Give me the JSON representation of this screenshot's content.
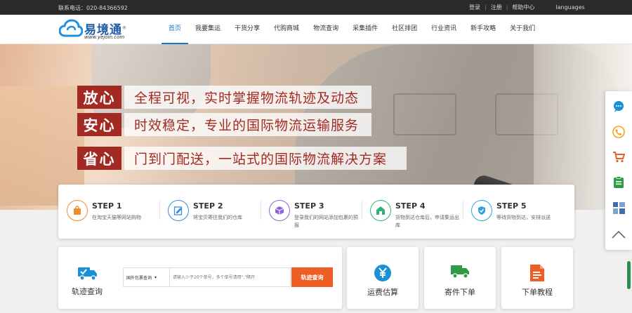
{
  "topbar": {
    "contact": "联系电话：020-84366592",
    "links": {
      "login": "登录",
      "register": "注册",
      "help": "帮助中心",
      "languages": "languages"
    }
  },
  "logo": {
    "name": "易境通",
    "reg": "®",
    "url": "www.yejoin.com"
  },
  "nav": {
    "items": [
      "首页",
      "我要集运",
      "干货分享",
      "代购商城",
      "物流查询",
      "采集插件",
      "社区排团",
      "行业资讯",
      "新手攻略",
      "关于我们"
    ],
    "active_index": 0
  },
  "banner": {
    "slogans": [
      {
        "tag": "放心",
        "text": "全程可视，实时掌握物流轨迹及动态"
      },
      {
        "tag": "安心",
        "text": "时效稳定，专业的国际物流运输服务"
      },
      {
        "tag": "省心",
        "text": "门到门配送，一站式的国际物流解决方案"
      }
    ]
  },
  "steps": [
    {
      "title": "STEP 1",
      "desc": "在淘宝天猫等网站购物",
      "icon": "shopping-bag-icon",
      "color": "#f08c2c"
    },
    {
      "title": "STEP 2",
      "desc": "将宝贝寄往我们的仓库",
      "icon": "edit-form-icon",
      "color": "#3b8be0"
    },
    {
      "title": "STEP 3",
      "desc": "登录我们的网站添加包裹的预报",
      "icon": "package-icon",
      "color": "#8a64d8"
    },
    {
      "title": "STEP 4",
      "desc": "货物到达仓库后，申请集运出库",
      "icon": "warehouse-icon",
      "color": "#2fb573"
    },
    {
      "title": "STEP 5",
      "desc": "等待货物到达，安排派送",
      "icon": "shield-check-icon",
      "color": "#2fa3e0"
    }
  ],
  "tracking": {
    "label": "轨迹查询",
    "select_value": "国外包裹查询",
    "placeholder": "请输入少于20个单号，多个单号请用\",\"隔开",
    "button": "轨迹查询"
  },
  "services": [
    {
      "label": "运费估算",
      "icon": "yen-coin-icon",
      "color": "#1a90d6"
    },
    {
      "label": "寄件下单",
      "icon": "truck-icon",
      "color": "#2e9b45"
    },
    {
      "label": "下单教程",
      "icon": "document-icon",
      "color": "#ee5d24"
    }
  ],
  "sidebar": [
    {
      "icon": "chat-bubble-icon",
      "color": "#1a90d6"
    },
    {
      "icon": "phone-icon",
      "color": "#f0a21d"
    },
    {
      "icon": "cart-icon",
      "color": "#ee5d24"
    },
    {
      "icon": "clipboard-icon",
      "color": "#2e9b45"
    },
    {
      "icon": "grid-icon",
      "color": "#3f6ea8"
    },
    {
      "icon": "back-to-top-icon",
      "color": "#666666"
    }
  ]
}
